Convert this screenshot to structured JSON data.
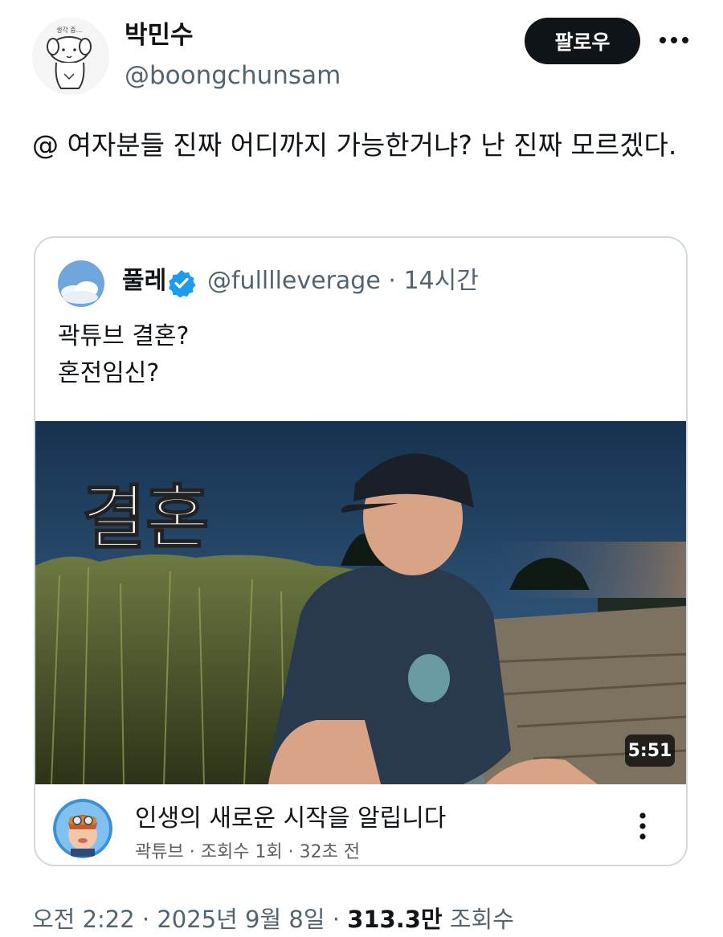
{
  "author": {
    "display_name": "박민수",
    "handle": "@boongchunsam",
    "avatar_icon": "dog-sketch-avatar-icon",
    "avatar_caption": "생각 중..."
  },
  "actions": {
    "follow_label": "팔로우",
    "more_icon": "more-horizontal-icon"
  },
  "tweet": {
    "text": "@ 여자분들 진짜 어디까지 가능한거냐? 난 진짜 모르겠다."
  },
  "quote": {
    "name": "풀레",
    "handle": "@fulllleverage",
    "separator": "·",
    "time": "14시간",
    "verified_icon": "verified-badge-icon",
    "text_line1": "곽튜브 결혼?",
    "text_line2": "혼전임신?",
    "video": {
      "thumbnail_text": "결혼",
      "duration": "5:51",
      "title": "인생의 새로운 시작을 알립니다",
      "meta": "곽튜브 · 조회수 1회 · 32초 전",
      "channel_icon": "cartoon-channel-avatar-icon",
      "more_icon": "more-vertical-icon"
    }
  },
  "footer": {
    "time": "오전 2:22",
    "sep1": "·",
    "date": "2025년 9월 8일",
    "sep2": "·",
    "views_count": "313.3만",
    "views_label": "조회수"
  },
  "colors": {
    "primary_text": "#0f1419",
    "secondary_text": "#536471",
    "verified_blue": "#1d9bf0",
    "follow_bg": "#0f1419",
    "card_border": "#cfd9de"
  }
}
